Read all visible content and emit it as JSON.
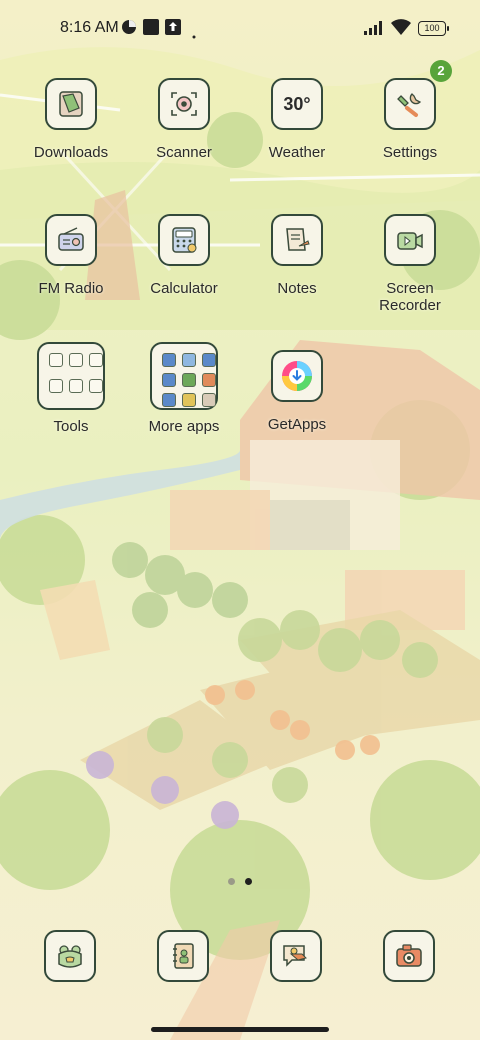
{
  "status_bar": {
    "time": "8:16 AM",
    "battery": "100"
  },
  "apps": [
    {
      "label": "Downloads",
      "icon": "downloads-icon"
    },
    {
      "label": "Scanner",
      "icon": "scanner-icon"
    },
    {
      "label": "Weather",
      "icon": "weather-icon",
      "icon_text": "30°"
    },
    {
      "label": "Settings",
      "icon": "settings-icon",
      "badge": "2"
    },
    {
      "label": "FM Radio",
      "icon": "radio-icon"
    },
    {
      "label": "Calculator",
      "icon": "calculator-icon"
    },
    {
      "label": "Notes",
      "icon": "notes-icon"
    },
    {
      "label": "Screen\nRecorder",
      "icon": "screen-recorder-icon"
    },
    {
      "label": "Tools",
      "icon": "folder-icon"
    },
    {
      "label": "More apps",
      "icon": "folder-icon"
    },
    {
      "label": "GetApps",
      "icon": "getapps-icon"
    }
  ],
  "dock": [
    {
      "icon": "phone-icon"
    },
    {
      "icon": "contacts-icon"
    },
    {
      "icon": "messages-icon"
    },
    {
      "icon": "camera-icon"
    }
  ],
  "page_indicator": {
    "pages": 2,
    "current": 2
  },
  "colors": {
    "icon_border": "#33493a",
    "icon_bg": "#f7f5e8",
    "badge": "#58a43a"
  }
}
